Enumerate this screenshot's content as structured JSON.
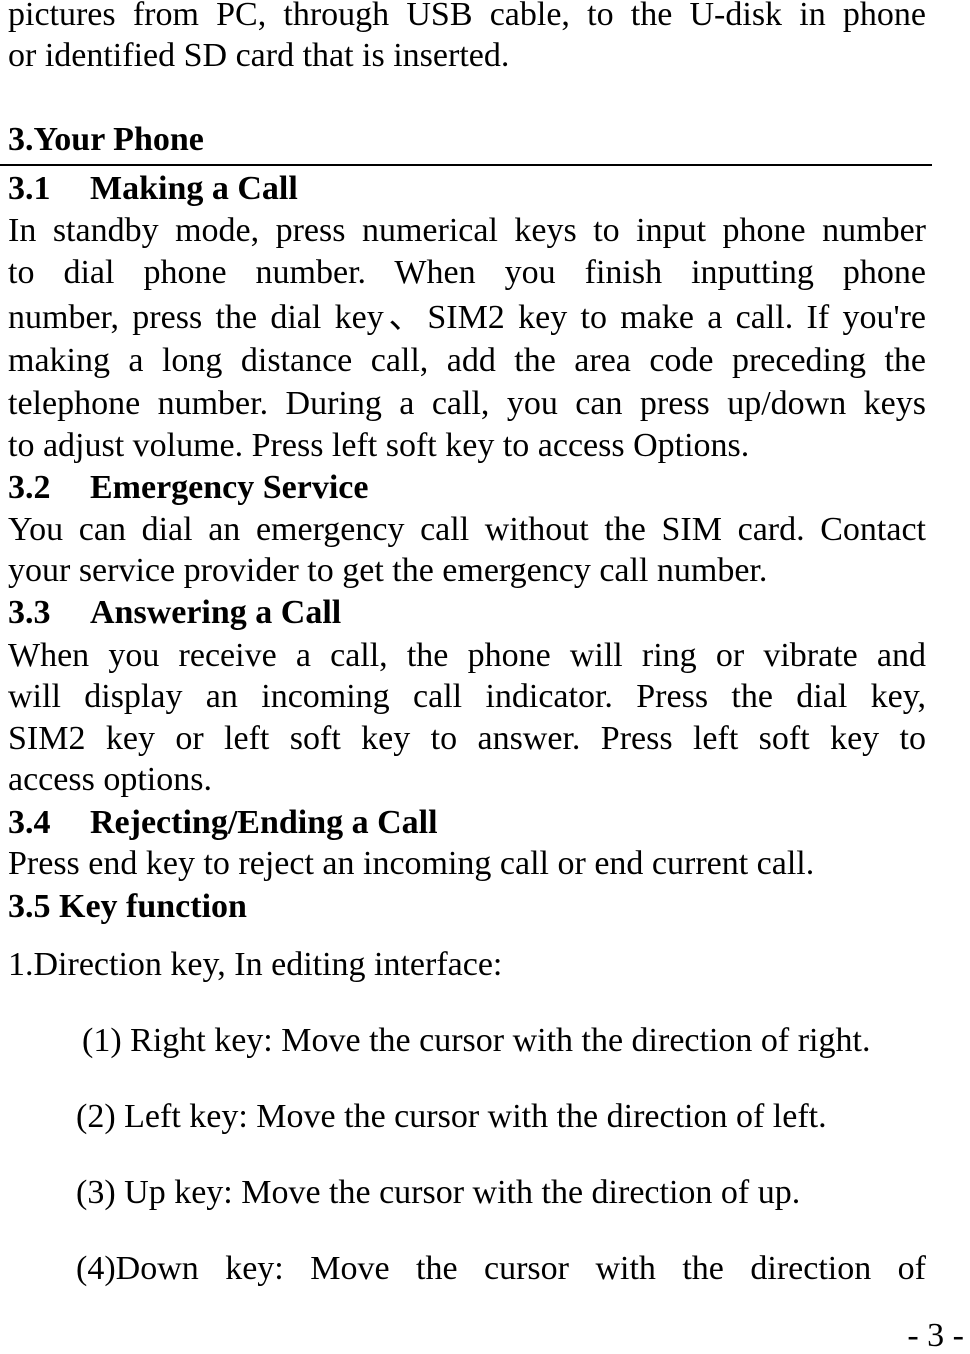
{
  "intro": {
    "lines": [
      "pictures from PC, through USB cable, to the U-disk in phone",
      "or identified SD card that is inserted."
    ]
  },
  "chapter": {
    "title": "3.Your Phone"
  },
  "sections": [
    {
      "num": "3.1",
      "title": "Making a Call",
      "lines": [
        "In standby mode, press numerical keys to input phone number",
        "to dial phone number. When you finish inputting phone",
        "number, press the dial key、SIM2 key to make a call. If you're",
        "making a long distance call, add the area code preceding the",
        "telephone number. During a call, you can press up/down keys",
        "to adjust volume. Press left soft key to access Options."
      ]
    },
    {
      "num": "3.2",
      "title": "Emergency Service",
      "lines": [
        "You can dial an emergency call without the SIM card. Contact",
        "your service provider to get the emergency call number."
      ]
    },
    {
      "num": "3.3",
      "title": "Answering a Call",
      "lines": [
        "When you receive a call, the phone will ring or vibrate and",
        "will display an incoming call indicator. Press the dial key,",
        "SIM2 key or left soft key to answer. Press left soft key to",
        "access options."
      ]
    },
    {
      "num": "3.4",
      "title": "Rejecting/Ending a Call",
      "lines": [
        "Press end key to reject an incoming call or end current call."
      ]
    }
  ],
  "key_function": {
    "title": "3.5 Key function",
    "intro": "1.Direction key, In editing interface:",
    "items": [
      "(1) Right key: Move the cursor with the direction of right.",
      "(2) Left key: Move the cursor with the direction of left.",
      "(3) Up key: Move the cursor with the direction of up.",
      "(4)Down key: Move the cursor with the direction of"
    ]
  },
  "footer": {
    "page_number": "- 3 -"
  }
}
